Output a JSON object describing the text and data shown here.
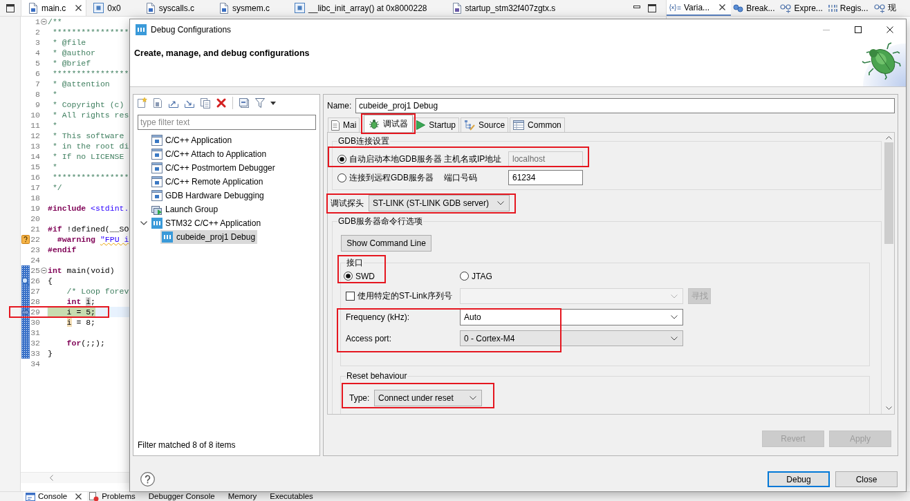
{
  "editor_tabs": [
    {
      "label": "main.c",
      "kind": "source",
      "selected": true
    },
    {
      "label": "0x0",
      "kind": "function",
      "selected": false
    },
    {
      "label": "syscalls.c",
      "kind": "source",
      "selected": false
    },
    {
      "label": "sysmem.c",
      "kind": "source",
      "selected": false
    },
    {
      "label": "__libc_init_array() at 0x8000228",
      "kind": "function",
      "selected": false
    },
    {
      "label": "startup_stm32f407zgtx.s",
      "kind": "assembly",
      "selected": false
    }
  ],
  "view_tabs": [
    {
      "label": "Varia...",
      "kind": "variables",
      "selected": true
    },
    {
      "label": "Break...",
      "kind": "breakpoints",
      "selected": false
    },
    {
      "label": "Expre...",
      "kind": "expressions",
      "selected": false
    },
    {
      "label": "Regis...",
      "kind": "registers",
      "selected": false
    },
    {
      "label": "现",
      "kind": "live-expressions",
      "selected": false
    }
  ],
  "code": {
    "blocks": [
      {
        "in_frame": false,
        "lines": [
          {
            "number": "1",
            "kind": "fold",
            "marked": false,
            "tokens": [
              {
                "kind": "comment",
                "text": "/**"
              }
            ]
          },
          {
            "number": "2",
            "kind": "plain",
            "marked": false,
            "tokens": [
              {
                "kind": "comment",
                "text": " ****************"
              }
            ]
          },
          {
            "number": "3",
            "kind": "plain",
            "marked": false,
            "tokens": [
              {
                "kind": "comment",
                "text": " * @file"
              }
            ]
          },
          {
            "number": "4",
            "kind": "plain",
            "marked": false,
            "tokens": [
              {
                "kind": "comment",
                "text": " * @author"
              }
            ]
          },
          {
            "number": "5",
            "kind": "plain",
            "marked": false,
            "tokens": [
              {
                "kind": "comment",
                "text": " * @brief"
              }
            ]
          },
          {
            "number": "6",
            "kind": "plain",
            "marked": false,
            "tokens": [
              {
                "kind": "comment",
                "text": " ****************"
              }
            ]
          },
          {
            "number": "7",
            "kind": "plain",
            "marked": false,
            "tokens": [
              {
                "kind": "comment",
                "text": " * @attention"
              }
            ]
          },
          {
            "number": "8",
            "kind": "plain",
            "marked": false,
            "tokens": [
              {
                "kind": "comment",
                "text": " *"
              }
            ]
          },
          {
            "number": "9",
            "kind": "plain",
            "marked": false,
            "tokens": [
              {
                "kind": "comment",
                "text": " * Copyright (c)"
              }
            ]
          },
          {
            "number": "10",
            "kind": "plain",
            "marked": false,
            "tokens": [
              {
                "kind": "comment",
                "text": " * All rights res"
              }
            ]
          },
          {
            "number": "11",
            "kind": "plain",
            "marked": false,
            "tokens": [
              {
                "kind": "comment",
                "text": " *"
              }
            ]
          },
          {
            "number": "12",
            "kind": "plain",
            "marked": false,
            "tokens": [
              {
                "kind": "comment",
                "text": " * This software"
              }
            ]
          },
          {
            "number": "13",
            "kind": "plain",
            "marked": false,
            "tokens": [
              {
                "kind": "comment",
                "text": " * in the root di"
              }
            ]
          },
          {
            "number": "14",
            "kind": "plain",
            "marked": false,
            "tokens": [
              {
                "kind": "comment",
                "text": " * If no LICENSE"
              }
            ]
          },
          {
            "number": "15",
            "kind": "plain",
            "marked": false,
            "tokens": [
              {
                "kind": "comment",
                "text": " *"
              }
            ]
          },
          {
            "number": "16",
            "kind": "plain",
            "marked": false,
            "tokens": [
              {
                "kind": "comment",
                "text": " ****************"
              }
            ]
          },
          {
            "number": "17",
            "kind": "plain",
            "marked": false,
            "tokens": [
              {
                "kind": "comment",
                "text": " */"
              }
            ]
          },
          {
            "number": "18",
            "kind": "plain",
            "marked": false
          },
          {
            "number": "19",
            "kind": "plain",
            "marked": false,
            "tokens": [
              {
                "kind": "keyword",
                "text": "#include"
              },
              {
                "kind": "string",
                "text": " <stdint."
              }
            ]
          },
          {
            "number": "20",
            "kind": "plain",
            "marked": false
          },
          {
            "number": "21",
            "kind": "plain",
            "marked": false,
            "tokens": [
              {
                "kind": "keyword",
                "text": "#if"
              },
              {
                "kind": "plain",
                "text": " !defined(__SO"
              }
            ]
          },
          {
            "number": "22",
            "kind": "warning",
            "marked": false,
            "tokens": [
              {
                "kind": "keyword",
                "text": "  #warning "
              },
              {
                "kind": "squiggle-string",
                "text": "\"FPU i"
              }
            ]
          },
          {
            "number": "23",
            "kind": "plain",
            "marked": false,
            "tokens": [
              {
                "kind": "keyword",
                "text": "#endif"
              }
            ]
          },
          {
            "number": "24",
            "kind": "plain",
            "marked": false
          }
        ]
      },
      {
        "in_frame": true,
        "lines": [
          {
            "number": "25",
            "kind": "fold",
            "marked": false,
            "tokens": [
              {
                "kind": "keyword",
                "text": "int"
              },
              {
                "kind": "plain",
                "text": " main(void)"
              }
            ]
          },
          {
            "number": "26",
            "kind": "breakpoint",
            "marked": false,
            "tokens": [
              {
                "kind": "plain",
                "text": "{"
              }
            ]
          },
          {
            "number": "27",
            "kind": "plain",
            "marked": false,
            "indented": true,
            "tokens": [
              {
                "kind": "comment",
                "text": "/* Loop forev"
              }
            ]
          },
          {
            "number": "28",
            "kind": "plain",
            "marked": false,
            "indented": true,
            "tokens": [
              {
                "kind": "keyword",
                "text": "int "
              },
              {
                "kind": "read-occurrence",
                "text": "i"
              },
              {
                "kind": "plain",
                "text": ";"
              }
            ]
          },
          {
            "number": "29",
            "kind": "current",
            "marked": true,
            "indented": true,
            "tokens": [
              {
                "kind": "plain",
                "text": "i = 5;"
              }
            ]
          },
          {
            "number": "30",
            "kind": "plain",
            "marked": false,
            "indented": true,
            "tokens": [
              {
                "kind": "write-occurrence",
                "text": "i"
              },
              {
                "kind": "plain",
                "text": " = 8;"
              }
            ]
          },
          {
            "number": "31",
            "kind": "plain",
            "marked": false
          },
          {
            "number": "32",
            "kind": "plain",
            "marked": false,
            "indented": true,
            "tokens": [
              {
                "kind": "keyword",
                "text": "for"
              },
              {
                "kind": "plain",
                "text": "(;;);"
              }
            ]
          },
          {
            "number": "33",
            "kind": "plain",
            "marked": false,
            "tokens": [
              {
                "kind": "plain",
                "text": "}"
              }
            ]
          }
        ]
      },
      {
        "in_frame": false,
        "lines": [
          {
            "number": "34",
            "kind": "plain",
            "marked": false
          }
        ]
      }
    ]
  },
  "dialog": {
    "title": "Debug Configurations",
    "heading": "Create, manage, and debug configurations",
    "filter": {
      "placeholder": "type filter text"
    },
    "tree": [
      {
        "label": "C/C++ Application",
        "kind": "c-launch",
        "selected": false
      },
      {
        "label": "C/C++ Attach to Application",
        "kind": "c-launch",
        "selected": false
      },
      {
        "label": "C/C++ Postmortem Debugger",
        "kind": "c-launch",
        "selected": false
      },
      {
        "label": "C/C++ Remote Application",
        "kind": "c-launch",
        "selected": false
      },
      {
        "label": "GDB Hardware Debugging",
        "kind": "c-launch",
        "selected": false
      },
      {
        "label": "Launch Group",
        "kind": "launch-group",
        "selected": false
      },
      {
        "label": "STM32 C/C++ Application",
        "kind": "stm32",
        "selected": false,
        "expanded": true,
        "children": [
          {
            "label": "cubeide_proj1 Debug",
            "kind": "stm32",
            "selected": true
          }
        ]
      }
    ],
    "filter_status": "Filter matched 8 of 8 items",
    "name": {
      "label": "Name:",
      "value": "cubeide_proj1 Debug"
    },
    "tabs": [
      {
        "label": "Mai",
        "kind": "main",
        "selected": false,
        "marked": false
      },
      {
        "label": "调试器",
        "kind": "debugger",
        "selected": true,
        "marked": true
      },
      {
        "label": "Startup",
        "kind": "startup",
        "selected": false,
        "marked": false
      },
      {
        "label": "Source",
        "kind": "source",
        "selected": false,
        "marked": false
      },
      {
        "label": "Common",
        "kind": "common",
        "selected": false,
        "marked": false
      }
    ],
    "connection": {
      "title": "GDB连接设置",
      "options": [
        {
          "label": "自动启动本地GDB服务器",
          "selected": true,
          "field_label": "主机名或IP地址",
          "field": {
            "value": "localhost",
            "disabled": true
          },
          "marked": true
        },
        {
          "label": "连接到远程GDB服务器",
          "selected": false,
          "field_label": "端口号码",
          "field": {
            "value": "61234",
            "disabled": false
          },
          "marked": false
        }
      ]
    },
    "probe": {
      "label": "调试探头",
      "value": "ST-LINK (ST-LINK GDB server)",
      "marked": true
    },
    "server_options": {
      "title": "GDB服务器命令行选项",
      "command_button": "Show Command Line",
      "interface": {
        "title": "接口",
        "options": [
          {
            "label": "SWD",
            "selected": true
          },
          {
            "label": "JTAG",
            "selected": false
          }
        ],
        "marked": true
      },
      "serial": {
        "label": "使用特定的ST-Link序列号",
        "checked": false,
        "selector": {
          "disabled": true
        },
        "button": {
          "label": "寻找",
          "disabled": true
        }
      },
      "settings": {
        "marked": true,
        "rows": [
          {
            "label": "Frequency (kHz):",
            "value": "Auto",
            "kind": "editable"
          },
          {
            "label": "Access port:",
            "value": "0 - Cortex-M4",
            "kind": "readonly"
          }
        ]
      },
      "reset": {
        "title": "Reset behaviour",
        "label": "Type:",
        "value": "Connect under reset",
        "marked": true
      }
    },
    "actions": [
      {
        "label": "Revert",
        "disabled": true
      },
      {
        "label": "Apply",
        "disabled": true
      }
    ],
    "buttons": [
      {
        "label": "Debug",
        "default": true
      },
      {
        "label": "Close",
        "default": false
      }
    ]
  },
  "bottom_tabs": [
    {
      "label": "Console",
      "kind": "console",
      "selected": true
    },
    {
      "label": "Problems",
      "kind": "problems",
      "selected": false
    },
    {
      "label": "Debugger Console",
      "selected": false
    },
    {
      "label": "Memory",
      "selected": false
    },
    {
      "label": "Executables",
      "selected": false
    }
  ]
}
